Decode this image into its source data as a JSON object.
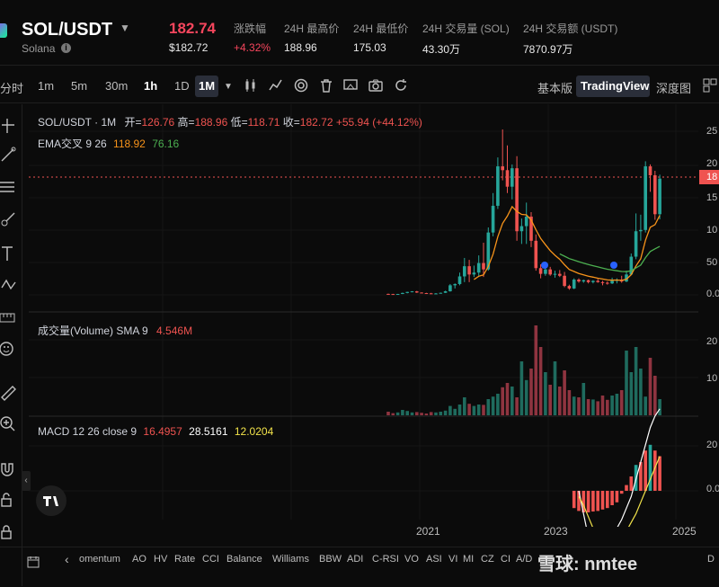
{
  "header": {
    "pair": "SOL/USDT",
    "subname": "Solana",
    "price": "182.74",
    "price_usd": "$182.72",
    "stats": [
      {
        "label": "涨跌幅",
        "value": "+4.32%"
      },
      {
        "label": "24H 最高价",
        "value": "188.96"
      },
      {
        "label": "24H 最低价",
        "value": "175.03"
      },
      {
        "label": "24H 交易量 (SOL)",
        "value": "43.30万"
      },
      {
        "label": "24H 交易额 (USDT)",
        "value": "7870.97万"
      }
    ]
  },
  "toolbar": {
    "timeframes": [
      "分时",
      "1m",
      "5m",
      "30m",
      "1h",
      "1D",
      "1M"
    ],
    "active_timeframe": "1M",
    "views": [
      "基本版",
      "TradingView",
      "深度图"
    ],
    "active_view": "TradingView"
  },
  "legend": {
    "main_title": "SOL/USDT · 1M",
    "ohlc": [
      {
        "label": "开=",
        "value": "126.76"
      },
      {
        "label": "高=",
        "value": "188.96"
      },
      {
        "label": "低=",
        "value": "118.71"
      },
      {
        "label": "收=",
        "value": "182.72"
      },
      {
        "label": "",
        "value": "+55.94 (+44.12%)"
      }
    ],
    "ema_name": "EMA交叉 9 26",
    "ema_fast": "118.92",
    "ema_slow": "76.16",
    "volume_name": "成交量(Volume) SMA 9",
    "volume_val": "4.546M",
    "macd_name": "MACD 12 26 close 9",
    "macd_vals": [
      "16.4957",
      "28.5161",
      "12.0204"
    ]
  },
  "axis": {
    "price_ticks": [
      "25",
      "20",
      "18",
      "15",
      "10",
      "50",
      "0.0"
    ],
    "volume_ticks": [
      "20",
      "10"
    ],
    "macd_ticks": [
      "20",
      "0.0"
    ],
    "dates": [
      "2021",
      "2023",
      "2025"
    ]
  },
  "indicators": [
    "omentum",
    "AO",
    "HV",
    "Rate",
    "CCI",
    "Balance",
    "Williams",
    "BBW",
    "ADI",
    "C-RSI",
    "VO",
    "ASI",
    "VI",
    "MI",
    "CZ",
    "CI",
    "A/D",
    "D"
  ],
  "watermark": "雪球: nmtee",
  "colors": {
    "up": "#26a69a",
    "down": "#ef5350",
    "bg": "#0b0b0b",
    "ema_fast": "#f7931a",
    "ema_slow": "#4caf50"
  },
  "chart_data": {
    "type": "candlestick",
    "title": "SOL/USDT · 1M",
    "candles": [
      {
        "o": 1.5,
        "h": 2.0,
        "l": 0.9,
        "c": 1.3
      },
      {
        "o": 1.3,
        "h": 1.6,
        "l": 1.0,
        "c": 1.1
      },
      {
        "o": 1.1,
        "h": 1.5,
        "l": 0.8,
        "c": 1.4
      },
      {
        "o": 1.4,
        "h": 3.5,
        "l": 1.2,
        "c": 3.0
      },
      {
        "o": 3.0,
        "h": 4.9,
        "l": 2.4,
        "c": 4.6
      },
      {
        "o": 4.6,
        "h": 5.8,
        "l": 4.0,
        "c": 5.5
      },
      {
        "o": 5.5,
        "h": 6.2,
        "l": 3.0,
        "c": 3.6
      },
      {
        "o": 3.6,
        "h": 4.0,
        "l": 2.6,
        "c": 2.8
      },
      {
        "o": 2.8,
        "h": 3.2,
        "l": 2.1,
        "c": 2.4
      },
      {
        "o": 2.4,
        "h": 3.1,
        "l": 1.8,
        "c": 2.0
      },
      {
        "o": 2.0,
        "h": 2.8,
        "l": 1.4,
        "c": 2.2
      },
      {
        "o": 2.2,
        "h": 3.6,
        "l": 2.0,
        "c": 3.2
      },
      {
        "o": 3.2,
        "h": 6.5,
        "l": 3.0,
        "c": 5.6
      },
      {
        "o": 5.6,
        "h": 17.0,
        "l": 5.0,
        "c": 15.0
      },
      {
        "o": 15.0,
        "h": 18.0,
        "l": 10.0,
        "c": 17.0
      },
      {
        "o": 17.0,
        "h": 35.0,
        "l": 15.0,
        "c": 29.0
      },
      {
        "o": 29.0,
        "h": 58.0,
        "l": 20.0,
        "c": 45.0
      },
      {
        "o": 45.0,
        "h": 55.0,
        "l": 20.0,
        "c": 32.0
      },
      {
        "o": 32.0,
        "h": 46.0,
        "l": 28.0,
        "c": 35.0
      },
      {
        "o": 35.0,
        "h": 62.0,
        "l": 30.0,
        "c": 50.0
      },
      {
        "o": 50.0,
        "h": 82.0,
        "l": 28.0,
        "c": 40.0
      },
      {
        "o": 40.0,
        "h": 106.0,
        "l": 38.0,
        "c": 98.0
      },
      {
        "o": 98.0,
        "h": 160.0,
        "l": 92.0,
        "c": 140.0
      },
      {
        "o": 140.0,
        "h": 216.0,
        "l": 135.0,
        "c": 202.0
      },
      {
        "o": 202.0,
        "h": 260.0,
        "l": 180.0,
        "c": 196.0
      },
      {
        "o": 196.0,
        "h": 235.0,
        "l": 160.0,
        "c": 170.0
      },
      {
        "o": 170.0,
        "h": 205.0,
        "l": 150.0,
        "c": 199.0
      },
      {
        "o": 199.0,
        "h": 218.0,
        "l": 85.0,
        "c": 100.0
      },
      {
        "o": 100.0,
        "h": 120.0,
        "l": 80.0,
        "c": 108.0
      },
      {
        "o": 108.0,
        "h": 145.0,
        "l": 80.0,
        "c": 123.0
      },
      {
        "o": 123.0,
        "h": 130.0,
        "l": 75.0,
        "c": 85.0
      },
      {
        "o": 85.0,
        "h": 95.0,
        "l": 38.0,
        "c": 42.0
      },
      {
        "o": 42.0,
        "h": 48.0,
        "l": 26.0,
        "c": 33.0
      },
      {
        "o": 33.0,
        "h": 47.0,
        "l": 30.0,
        "c": 40.0
      },
      {
        "o": 40.0,
        "h": 44.0,
        "l": 30.0,
        "c": 32.0
      },
      {
        "o": 32.0,
        "h": 38.0,
        "l": 27.0,
        "c": 33.0
      },
      {
        "o": 33.0,
        "h": 39.0,
        "l": 28.0,
        "c": 30.0
      },
      {
        "o": 30.0,
        "h": 36.0,
        "l": 12.0,
        "c": 14.0
      },
      {
        "o": 14.0,
        "h": 16.0,
        "l": 8.0,
        "c": 10.0
      },
      {
        "o": 10.0,
        "h": 26.0,
        "l": 9.0,
        "c": 24.0
      },
      {
        "o": 24.0,
        "h": 26.0,
        "l": 19.0,
        "c": 21.0
      },
      {
        "o": 21.0,
        "h": 24.0,
        "l": 19.0,
        "c": 23.0
      },
      {
        "o": 23.0,
        "h": 24.0,
        "l": 18.0,
        "c": 20.0
      },
      {
        "o": 20.0,
        "h": 23.0,
        "l": 18.0,
        "c": 22.0
      },
      {
        "o": 22.0,
        "h": 25.0,
        "l": 19.0,
        "c": 20.0
      },
      {
        "o": 20.0,
        "h": 22.0,
        "l": 15.0,
        "c": 19.0
      },
      {
        "o": 19.0,
        "h": 21.0,
        "l": 16.0,
        "c": 18.0
      },
      {
        "o": 18.0,
        "h": 27.0,
        "l": 17.0,
        "c": 22.0
      },
      {
        "o": 22.0,
        "h": 26.0,
        "l": 18.0,
        "c": 24.0
      },
      {
        "o": 24.0,
        "h": 30.0,
        "l": 19.0,
        "c": 21.0
      },
      {
        "o": 21.0,
        "h": 38.0,
        "l": 20.0,
        "c": 32.0
      },
      {
        "o": 32.0,
        "h": 65.0,
        "l": 31.0,
        "c": 60.0
      },
      {
        "o": 60.0,
        "h": 128.0,
        "l": 56.0,
        "c": 100.0
      },
      {
        "o": 100.0,
        "h": 126.0,
        "l": 85.0,
        "c": 102.0
      },
      {
        "o": 102.0,
        "h": 210.0,
        "l": 98.0,
        "c": 202.0
      },
      {
        "o": 202.0,
        "h": 205.0,
        "l": 162.0,
        "c": 188.0
      },
      {
        "o": 188.0,
        "h": 195.0,
        "l": 118.0,
        "c": 126.76
      },
      {
        "o": 126.76,
        "h": 188.96,
        "l": 118.71,
        "c": 182.72
      }
    ],
    "volume": [
      1.0,
      0.6,
      0.8,
      1.5,
      1.2,
      0.8,
      0.9,
      0.7,
      0.5,
      0.9,
      0.8,
      1.0,
      1.3,
      2.6,
      1.8,
      3.0,
      5.0,
      3.2,
      2.6,
      3.0,
      2.9,
      4.5,
      5.2,
      6.0,
      7.8,
      9.0,
      8.0,
      5.0,
      15.0,
      9.8,
      13.0,
      25.0,
      19.0,
      12.0,
      8.5,
      15.0,
      8.0,
      12.5,
      7.0,
      5.2,
      5.0,
      9.0,
      4.5,
      4.4,
      3.9,
      5.5,
      4.3,
      5.5,
      6.0,
      7.0,
      18.0,
      12.0,
      19.0,
      13.0,
      5.2,
      16.0,
      11.0,
      4.5
    ],
    "ema_fast": [
      1.3,
      1.2,
      1.2,
      1.7,
      2.3,
      2.9,
      3.0,
      2.9,
      2.8,
      2.6,
      2.5,
      2.6,
      3.2,
      5.6,
      7.9,
      12.1,
      18.7,
      21.4,
      24.1,
      29.3,
      31.4,
      44.7,
      63.8,
      91.4,
      112.3,
      123.8,
      138.8,
      131.1,
      126.5,
      125.8,
      117.6,
      102.5,
      88.6,
      78.9,
      69.5,
      62.2,
      55.8,
      47.4,
      39.9,
      36.7,
      33.6,
      31.5,
      29.2,
      27.8,
      26.2,
      24.8,
      23.4,
      23.1,
      23.3,
      22.8,
      24.6,
      31.7,
      45.4,
      56.7,
      85.8,
      106.3,
      110.4,
      124.9
    ],
    "ema_slow": [
      1.3,
      1.3,
      1.3,
      1.4,
      1.6,
      1.9,
      2.0,
      2.0,
      2.0,
      2.0,
      2.0,
      2.1,
      2.4,
      3.3,
      4.3,
      6.1,
      9.0,
      10.8,
      12.6,
      15.4,
      17.2,
      23.2,
      31.8,
      44.4,
      55.7,
      64.2,
      74.2,
      76.1,
      78.5,
      81.8,
      82.0,
      79.0,
      75.6,
      72.9,
      69.9,
      67.2,
      64.5,
      60.8,
      57.0,
      54.6,
      52.1,
      49.9,
      47.7,
      45.8,
      43.9,
      42.1,
      40.3,
      39.0,
      37.9,
      36.7,
      36.4,
      37.8,
      42.3,
      46.8,
      58.5,
      68.1,
      72.4,
      76.16
    ],
    "macd_hist": [
      0,
      0,
      0,
      0,
      0,
      0,
      0,
      0,
      0,
      0,
      0,
      0,
      0,
      0,
      0,
      0,
      0,
      0,
      0,
      0,
      0,
      0,
      0,
      0,
      0,
      0,
      0,
      0,
      0,
      0,
      0,
      0,
      0,
      0,
      0,
      0,
      0,
      0,
      0,
      -6,
      -7,
      -7.5,
      -7.5,
      -7.2,
      -7,
      -6.5,
      -6,
      -5,
      -4,
      -1,
      2,
      5,
      9,
      10,
      14,
      16,
      14,
      12.02
    ]
  }
}
